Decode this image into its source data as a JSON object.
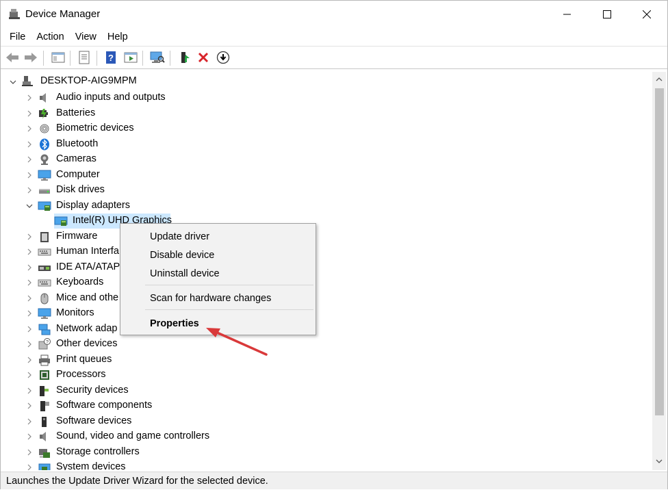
{
  "window": {
    "title": "Device Manager"
  },
  "menu": [
    "File",
    "Action",
    "View",
    "Help"
  ],
  "toolbar": {
    "buttons": [
      "back-icon",
      "forward-icon",
      "show-hide-tree-icon",
      "properties-icon",
      "help-icon",
      "run-action-icon",
      "scan-hardware-icon",
      "update-driver-icon",
      "uninstall-icon",
      "download-icon"
    ]
  },
  "tree": {
    "root": "DESKTOP-AIG9MPM",
    "categories": [
      {
        "label": "Audio inputs and outputs",
        "icon": "speaker-icon"
      },
      {
        "label": "Batteries",
        "icon": "battery-icon"
      },
      {
        "label": "Biometric devices",
        "icon": "fingerprint-icon"
      },
      {
        "label": "Bluetooth",
        "icon": "bluetooth-icon"
      },
      {
        "label": "Cameras",
        "icon": "camera-icon"
      },
      {
        "label": "Computer",
        "icon": "monitor-icon"
      },
      {
        "label": "Disk drives",
        "icon": "disk-drive-icon"
      },
      {
        "label": "Display adapters",
        "icon": "display-adapter-icon"
      },
      {
        "label": "Intel(R) UHD Graphics",
        "icon": "display-adapter-icon"
      },
      {
        "label": "Firmware",
        "icon": "chip-icon"
      },
      {
        "label": "Human Interfa",
        "icon": "keyboard-icon"
      },
      {
        "label": "IDE ATA/ATAPI c",
        "icon": "ide-controller-icon"
      },
      {
        "label": "Keyboards",
        "icon": "keyboard-icon"
      },
      {
        "label": "Mice and othe",
        "icon": "mouse-icon"
      },
      {
        "label": "Monitors",
        "icon": "monitor-icon"
      },
      {
        "label": "Network adap",
        "icon": "network-icon"
      },
      {
        "label": "Other devices",
        "icon": "unknown-device-icon"
      },
      {
        "label": "Print queues",
        "icon": "printer-icon"
      },
      {
        "label": "Processors",
        "icon": "processor-icon"
      },
      {
        "label": "Security devices",
        "icon": "security-device-icon"
      },
      {
        "label": "Software components",
        "icon": "software-component-icon"
      },
      {
        "label": "Software devices",
        "icon": "software-device-icon"
      },
      {
        "label": "Sound, video and game controllers",
        "icon": "speaker-icon"
      },
      {
        "label": "Storage controllers",
        "icon": "storage-controller-icon"
      },
      {
        "label": "System devices",
        "icon": "system-device-icon"
      }
    ]
  },
  "context_menu": {
    "items": [
      "Update driver",
      "Disable device",
      "Uninstall device",
      "Scan for hardware changes",
      "Properties"
    ]
  },
  "status": {
    "text": "Launches the Update Driver Wizard for the selected device."
  },
  "colors": {
    "selection": "#cce8ff",
    "annotation_arrow": "#d9393a"
  }
}
